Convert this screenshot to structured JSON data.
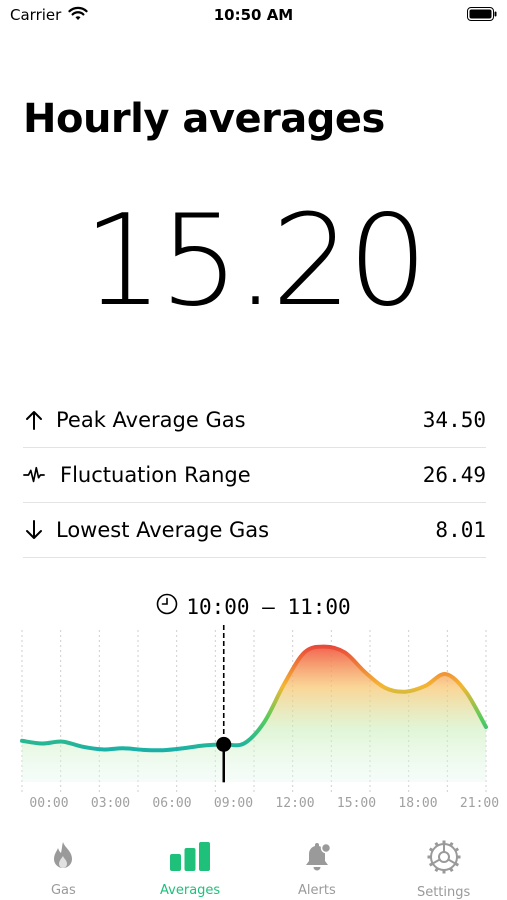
{
  "status_bar": {
    "carrier": "Carrier",
    "time": "10:50 AM"
  },
  "page": {
    "title": "Hourly averages",
    "current_value": "15.20"
  },
  "stats": [
    {
      "icon": "arrow-up-icon",
      "label": "Peak Average Gas",
      "value": "34.50"
    },
    {
      "icon": "waveform-icon",
      "label": "Fluctuation Range",
      "value": "26.49"
    },
    {
      "icon": "arrow-down-icon",
      "label": "Lowest Average Gas",
      "value": "8.01"
    }
  ],
  "chart": {
    "selected_range": "10:00 – 11:00",
    "x_labels": [
      "00:00",
      "03:00",
      "06:00",
      "09:00",
      "12:00",
      "15:00",
      "18:00",
      "21:00"
    ]
  },
  "chart_data": {
    "type": "area",
    "title": "",
    "xlabel": "",
    "ylabel": "",
    "x": [
      0,
      1,
      2,
      3,
      4,
      5,
      6,
      7,
      8,
      9,
      10,
      11,
      12,
      13,
      14,
      15,
      16,
      17,
      18,
      19,
      20,
      21,
      22,
      23
    ],
    "values": [
      10.5,
      9.8,
      10.3,
      9.0,
      8.3,
      8.6,
      8.2,
      8.1,
      8.6,
      9.3,
      9.6,
      9.8,
      15.2,
      25.0,
      33.0,
      34.5,
      33.0,
      28.0,
      24.0,
      23.0,
      24.5,
      27.5,
      23.0,
      14.0
    ],
    "ylim": [
      0,
      40
    ],
    "selected_hour": 10,
    "colors": {
      "low": "#18b0a8",
      "mid": "#7fd34a",
      "high": "#e84a3a",
      "fill_low": "#d8f5ec"
    }
  },
  "tabs": [
    {
      "icon": "flame-icon",
      "label": "Gas",
      "active": false
    },
    {
      "icon": "bar-chart-icon",
      "label": "Averages",
      "active": true
    },
    {
      "icon": "bell-alert-icon",
      "label": "Alerts",
      "active": false
    },
    {
      "icon": "gear-icon",
      "label": "Settings",
      "active": false
    }
  ],
  "theme": {
    "accent": "#1fc07a",
    "inactive": "#9a9a9a"
  }
}
